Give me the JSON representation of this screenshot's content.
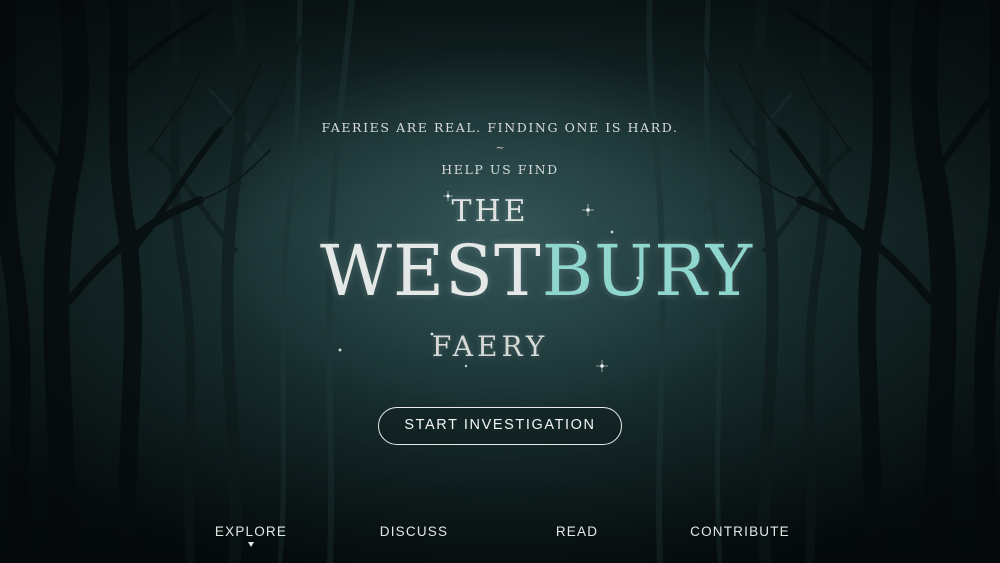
{
  "hero": {
    "tagline": "FAERIES ARE REAL. FINDING ONE IS HARD.",
    "separator": "~",
    "subtagline": "HELP US FIND"
  },
  "logo": {
    "the": "THE",
    "word_part_a": "WEST",
    "word_part_b": "BURY",
    "faery": "FAERY",
    "colors": {
      "silver": "#e4e8e6",
      "teal": "#8fd6cf"
    }
  },
  "cta": {
    "label": "START INVESTIGATION"
  },
  "nav": {
    "items": [
      {
        "label": "EXPLORE",
        "active": true
      },
      {
        "label": "DISCUSS",
        "active": false
      },
      {
        "label": "READ",
        "active": false
      },
      {
        "label": "CONTRIBUTE",
        "active": false
      }
    ]
  },
  "theme": {
    "background": "#0b1718",
    "text": "#e3e8e6"
  }
}
